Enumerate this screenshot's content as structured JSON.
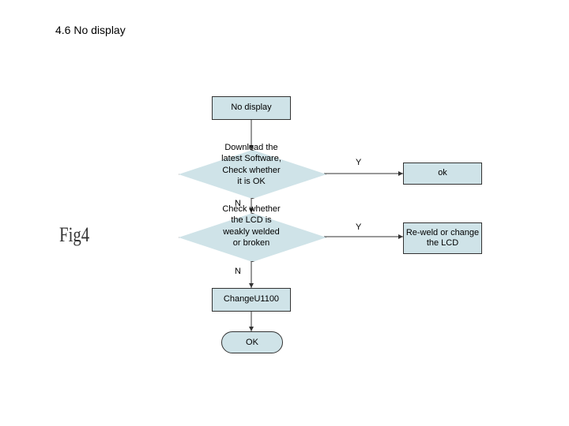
{
  "title": "4.6 No display",
  "figure_label": "Fig4",
  "nodes": {
    "start": "No display",
    "decision1": "Download the latest Software, Check whether it is OK",
    "result1": "ok",
    "decision2": "Check whether the LCD is weakly welded or broken",
    "result2": "Re-weld or change the LCD",
    "process3": "ChangeU1100",
    "terminator": "OK"
  },
  "edges": {
    "yes": "Y",
    "no": "N"
  },
  "colors": {
    "fill": "#cfe3e8",
    "stroke": "#333333"
  }
}
